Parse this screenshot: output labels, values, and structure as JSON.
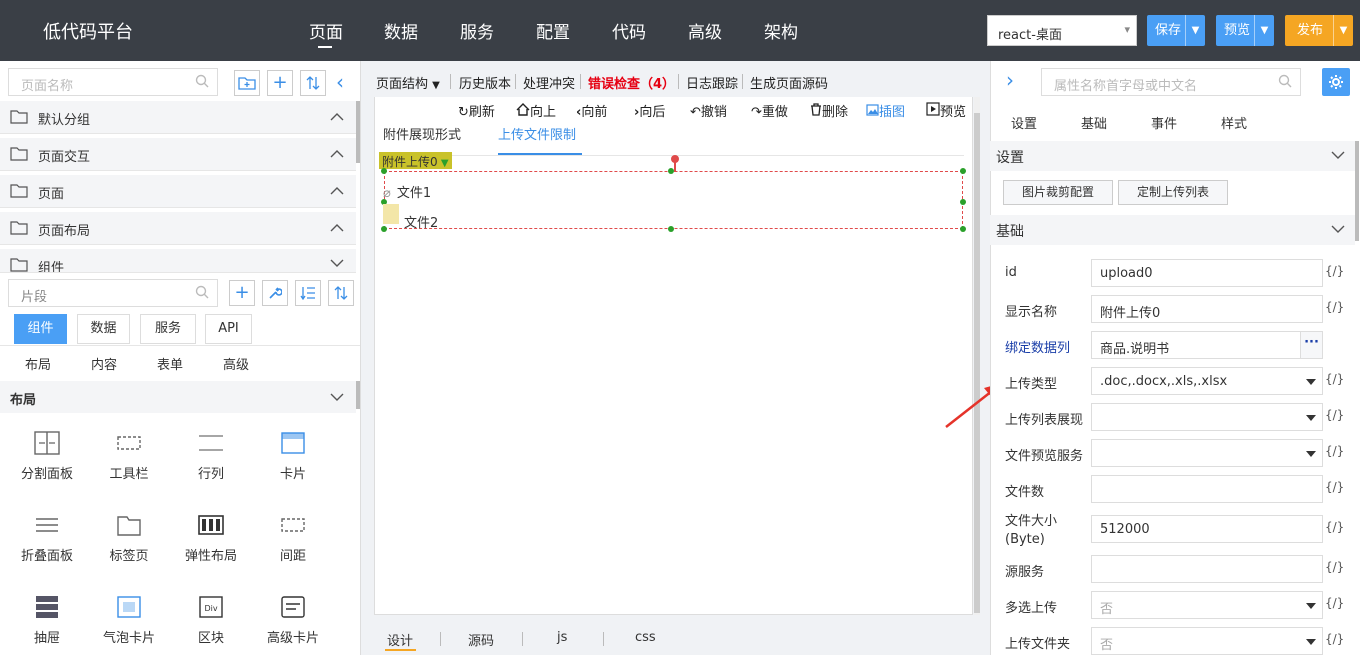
{
  "app": {
    "title": "低代码平台"
  },
  "nav": [
    "页面",
    "数据",
    "服务",
    "配置",
    "代码",
    "高级",
    "架构"
  ],
  "header": {
    "env": "react-桌面",
    "save": "保存",
    "preview": "预览",
    "publish": "发布"
  },
  "colors": {
    "topbar": "#3a3f46",
    "accent": "#3a8ee6",
    "publish": "#f5a623",
    "error": "#e60012"
  },
  "left": {
    "page_search_placeholder": "页面名称",
    "groups": [
      "默认分组",
      "页面交互",
      "页面",
      "页面布局",
      "组件"
    ],
    "fragment_placeholder": "片段",
    "tabs": [
      "组件",
      "数据",
      "服务",
      "API"
    ],
    "subtabs": [
      "布局",
      "内容",
      "表单",
      "高级"
    ],
    "section": "布局",
    "components": [
      "分割面板",
      "工具栏",
      "行列",
      "卡片",
      "折叠面板",
      "标签页",
      "弹性布局",
      "间距",
      "抽屉",
      "气泡卡片",
      "区块",
      "高级卡片"
    ]
  },
  "center": {
    "toolbar": [
      "页面结构",
      "历史版本",
      "处理冲突",
      "错误检查（4）",
      "日志跟踪",
      "生成页面源码"
    ],
    "actions": [
      "刷新",
      "向上",
      "向前",
      "向后",
      "撤销",
      "重做",
      "删除",
      "插图",
      "预览"
    ],
    "tabs": [
      "附件展现形式",
      "上传文件限制"
    ],
    "component_badge": "附件上传0",
    "files": [
      "文件1",
      "文件2"
    ],
    "bottom_tabs": [
      "设计",
      "源码",
      "js",
      "css"
    ]
  },
  "right": {
    "search_placeholder": "属性名称首字母或中文名",
    "tabs": [
      "设置",
      "基础",
      "事件",
      "样式"
    ],
    "section_settings": "设置",
    "buttons": [
      "图片裁剪配置",
      "定制上传列表"
    ],
    "section_basic": "基础",
    "fx": "{/}",
    "props": [
      {
        "label": "id",
        "value": "upload0"
      },
      {
        "label": "显示名称",
        "value": "附件上传0"
      },
      {
        "label": "绑定数据列",
        "value": "商品.说明书"
      },
      {
        "label": "上传类型",
        "value": ".doc,.docx,.xls,.xlsx"
      },
      {
        "label": "上传列表展现",
        "value": ""
      },
      {
        "label": "文件预览服务",
        "value": ""
      },
      {
        "label": "文件数",
        "value": ""
      },
      {
        "label": "文件大小",
        "label2": "(Byte)",
        "value": "512000"
      },
      {
        "label": "源服务",
        "value": ""
      },
      {
        "label": "多选上传",
        "value": "否"
      },
      {
        "label": "上传文件夹",
        "value": "否"
      }
    ]
  }
}
